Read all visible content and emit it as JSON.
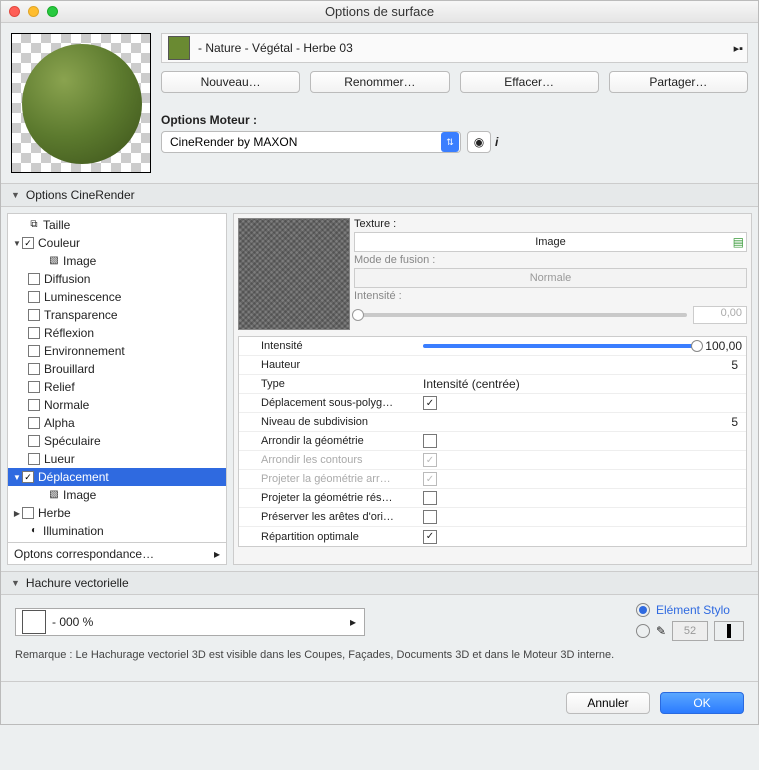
{
  "title": "Options de surface",
  "breadcrumb": "- Nature - Végétal - Herbe 03",
  "buttons": {
    "new": "Nouveau…",
    "rename": "Renommer…",
    "delete": "Effacer…",
    "share": "Partager…"
  },
  "engine": {
    "label": "Options Moteur :",
    "value": "CineRender by MAXON"
  },
  "section1": "Options CineRender",
  "tree": {
    "taille": "Taille",
    "couleur": "Couleur",
    "image": "Image",
    "diffusion": "Diffusion",
    "luminescence": "Luminescence",
    "transparence": "Transparence",
    "reflexion": "Réflexion",
    "environnement": "Environnement",
    "brouillard": "Brouillard",
    "relief": "Relief",
    "normale": "Normale",
    "alpha": "Alpha",
    "speculaire": "Spéculaire",
    "lueur": "Lueur",
    "deplacement": "Déplacement",
    "herbe": "Herbe",
    "illumination": "Illumination"
  },
  "correspondance": "Optons correspondance…",
  "right": {
    "texture_label": "Texture :",
    "texture_value": "Image",
    "blend_label": "Mode de fusion :",
    "blend_value": "Normale",
    "intensity_label": "Intensité :",
    "intensity_value": "0,00",
    "props": {
      "intensite": "Intensité",
      "intensite_v": "100,00",
      "hauteur": "Hauteur",
      "hauteur_v": "5",
      "type": "Type",
      "type_v": "Intensité (centrée)",
      "depsub": "Déplacement sous-polyg…",
      "nivsub": "Niveau de subdivision",
      "nivsub_v": "5",
      "arrgeo": "Arrondir la géométrie",
      "arrcnt": "Arrondir les contours",
      "prjarr": "Projeter la géométrie arr…",
      "prjres": "Projeter la géométrie rés…",
      "presar": "Préserver les arêtes d'ori…",
      "repopt": "Répartition optimale"
    }
  },
  "section2": "Hachure vectorielle",
  "hach_value": "- 000 %",
  "stylo": {
    "elem": "Elément Stylo",
    "pen": "52"
  },
  "remark": "Remarque : Le Hachurage vectoriel 3D est visible dans les Coupes, Façades, Documents 3D et dans le Moteur 3D interne.",
  "dlg": {
    "cancel": "Annuler",
    "ok": "OK"
  }
}
